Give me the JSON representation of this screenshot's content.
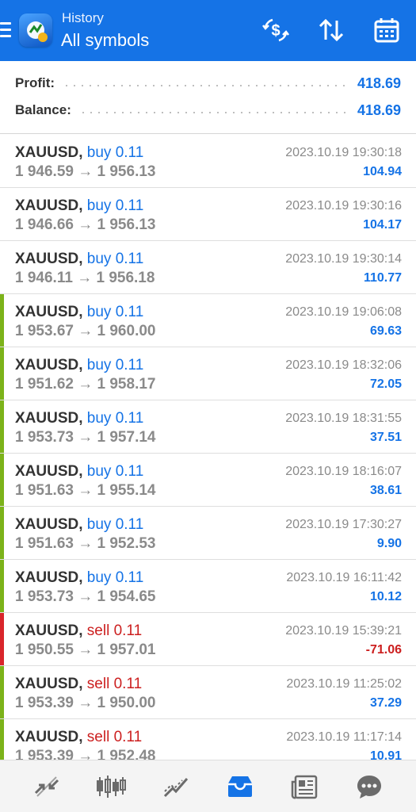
{
  "header": {
    "subtitle": "History",
    "title": "All symbols",
    "accent_color": "#1573e6",
    "icons": [
      "menu-icon",
      "app-logo",
      "currency-exchange-icon",
      "sort-icon",
      "calendar-icon"
    ]
  },
  "summary": {
    "profit_label": "Profit:",
    "profit_value": "418.69",
    "balance_label": "Balance:",
    "balance_value": "418.69"
  },
  "deals": [
    {
      "symbol": "XAUUSD,",
      "side": "buy 0.11",
      "type": "buy",
      "prices": "1 946.59 → 1 956.13",
      "time": "2023.10.19 19:30:18",
      "profit": "104.94",
      "bar": "none"
    },
    {
      "symbol": "XAUUSD,",
      "side": "buy 0.11",
      "type": "buy",
      "prices": "1 946.66 → 1 956.13",
      "time": "2023.10.19 19:30:16",
      "profit": "104.17",
      "bar": "none"
    },
    {
      "symbol": "XAUUSD,",
      "side": "buy 0.11",
      "type": "buy",
      "prices": "1 946.11 → 1 956.18",
      "time": "2023.10.19 19:30:14",
      "profit": "110.77",
      "bar": "none"
    },
    {
      "symbol": "XAUUSD,",
      "side": "buy 0.11",
      "type": "buy",
      "prices": "1 953.67 → 1 960.00",
      "time": "2023.10.19 19:06:08",
      "profit": "69.63",
      "bar": "#7cb31a"
    },
    {
      "symbol": "XAUUSD,",
      "side": "buy 0.11",
      "type": "buy",
      "prices": "1 951.62 → 1 958.17",
      "time": "2023.10.19 18:32:06",
      "profit": "72.05",
      "bar": "#7cb31a"
    },
    {
      "symbol": "XAUUSD,",
      "side": "buy 0.11",
      "type": "buy",
      "prices": "1 953.73 → 1 957.14",
      "time": "2023.10.19 18:31:55",
      "profit": "37.51",
      "bar": "#7cb31a"
    },
    {
      "symbol": "XAUUSD,",
      "side": "buy 0.11",
      "type": "buy",
      "prices": "1 951.63 → 1 955.14",
      "time": "2023.10.19 18:16:07",
      "profit": "38.61",
      "bar": "#7cb31a"
    },
    {
      "symbol": "XAUUSD,",
      "side": "buy 0.11",
      "type": "buy",
      "prices": "1 951.63 → 1 952.53",
      "time": "2023.10.19 17:30:27",
      "profit": "9.90",
      "bar": "#7cb31a"
    },
    {
      "symbol": "XAUUSD,",
      "side": "buy 0.11",
      "type": "buy",
      "prices": "1 953.73 → 1 954.65",
      "time": "2023.10.19 16:11:42",
      "profit": "10.12",
      "bar": "#7cb31a"
    },
    {
      "symbol": "XAUUSD,",
      "side": "sell 0.11",
      "type": "sell",
      "prices": "1 950.55 → 1 957.01",
      "time": "2023.10.19 15:39:21",
      "profit": "-71.06",
      "bar": "#d9252b"
    },
    {
      "symbol": "XAUUSD,",
      "side": "sell 0.11",
      "type": "sell",
      "prices": "1 953.39 → 1 950.00",
      "time": "2023.10.19 11:25:02",
      "profit": "37.29",
      "bar": "#7cb31a"
    },
    {
      "symbol": "XAUUSD,",
      "side": "sell 0.11",
      "type": "sell",
      "prices": "1 953.39 → 1 952.48",
      "time": "2023.10.19 11:17:14",
      "profit": "10.91",
      "bar": "#7cb31a"
    }
  ],
  "bottom_nav": {
    "items": [
      "quotes-icon",
      "chart-icon",
      "trade-icon",
      "history-icon",
      "news-icon",
      "messages-icon"
    ],
    "active": "history-icon",
    "active_color": "#1573e6",
    "inactive_color": "#6b6b6b"
  }
}
